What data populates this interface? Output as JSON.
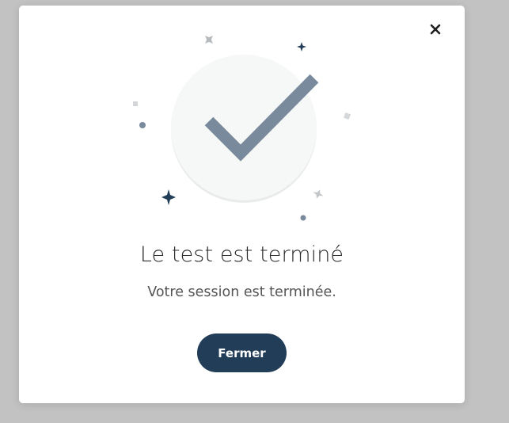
{
  "dialog": {
    "title": "Le test est terminé",
    "message": "Votre session est terminée.",
    "close_button_label": "Fermer"
  },
  "icons": {
    "close": "close-icon",
    "completion": "checkmark-icon"
  },
  "colors": {
    "primary_button": "#223d58",
    "checkmark": "#788a9c",
    "badge_circle": "#f6f7f7",
    "backdrop": "#c2c2c2"
  }
}
